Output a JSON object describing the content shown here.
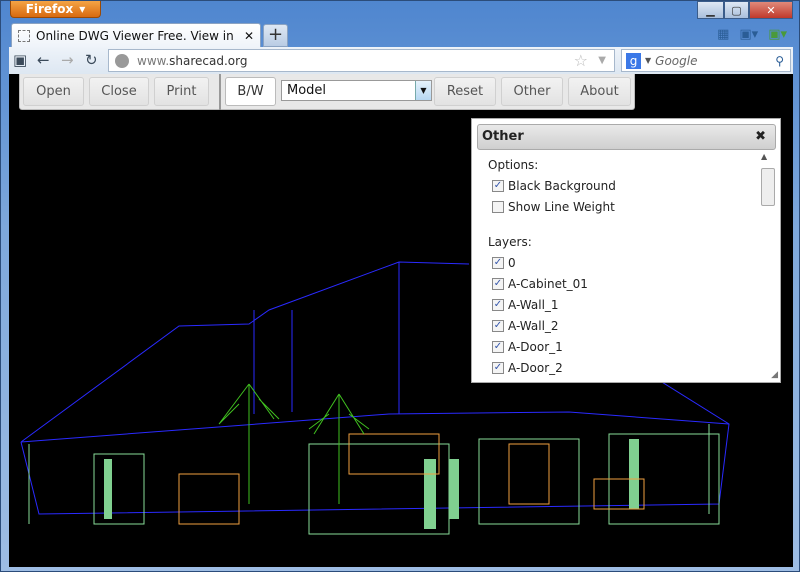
{
  "browser": {
    "menu_button": "Firefox",
    "tab_title": "Online DWG Viewer Free. View in web...",
    "new_tab": "+",
    "url_host": "www.",
    "url_domain": "sharecad.org",
    "search_placeholder": "Google",
    "search_engine": "g"
  },
  "toolbar": {
    "open": "Open",
    "close": "Close",
    "print": "Print",
    "bw": "B/W",
    "view_select": "Model",
    "reset": "Reset",
    "other": "Other",
    "about": "About"
  },
  "panel": {
    "title": "Other",
    "options_label": "Options:",
    "options": [
      {
        "label": "Black Background",
        "checked": true
      },
      {
        "label": "Show Line Weight",
        "checked": false
      }
    ],
    "layers_label": "Layers:",
    "layers": [
      {
        "label": "0",
        "checked": true
      },
      {
        "label": "A-Cabinet_01",
        "checked": true
      },
      {
        "label": "A-Wall_1",
        "checked": true
      },
      {
        "label": "A-Wall_2",
        "checked": true
      },
      {
        "label": "A-Door_1",
        "checked": true
      },
      {
        "label": "A-Door_2",
        "checked": true
      }
    ]
  },
  "colors": {
    "canvas": "#000000",
    "roof_lines": "#2020ff",
    "walls": "#90e0a0",
    "furniture": "#f0a040",
    "trees": "#40c020"
  }
}
